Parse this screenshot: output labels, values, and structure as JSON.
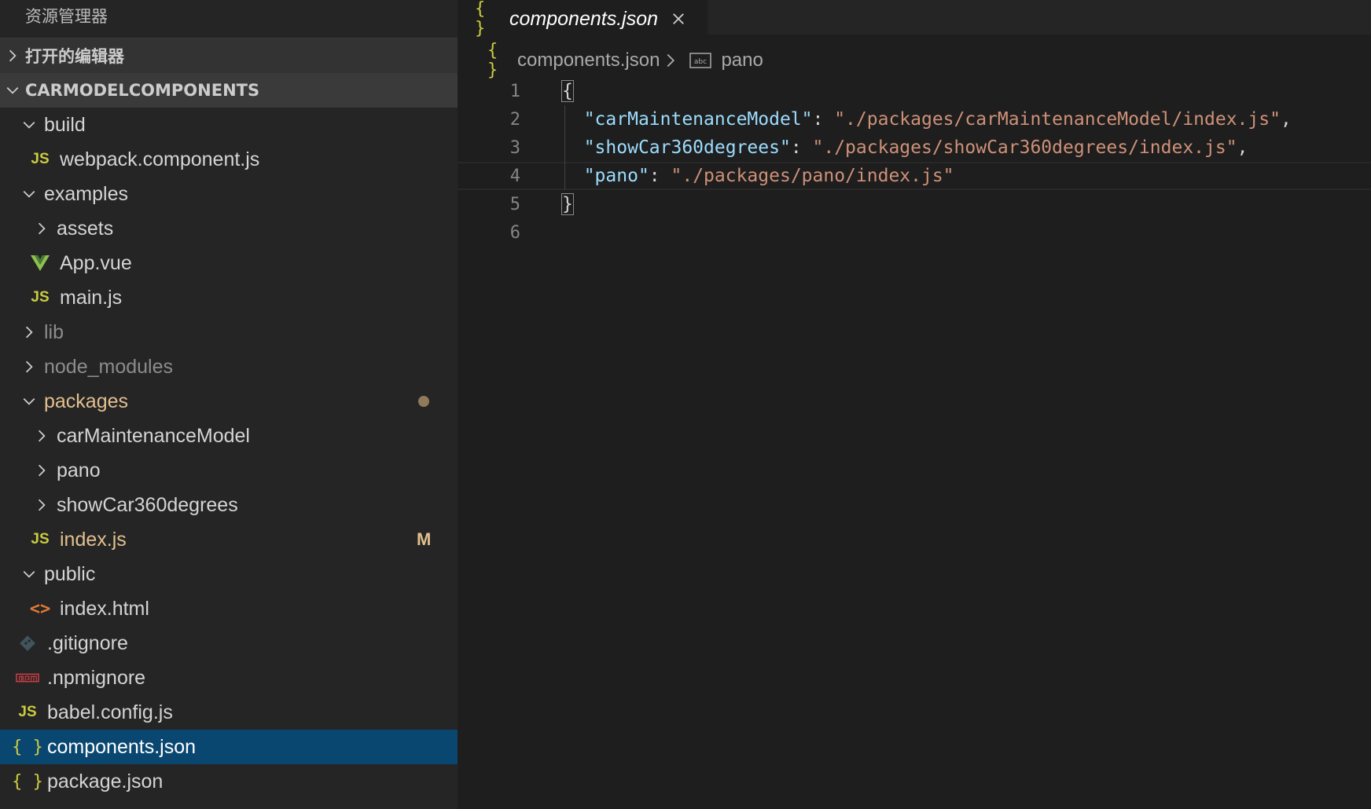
{
  "sidebar": {
    "title": "资源管理器",
    "open_editors_label": "打开的编辑器",
    "root_label": "CARMODELCOMPONENTS",
    "tree": [
      {
        "label": "build",
        "indent": 1,
        "kind": "folder",
        "open": true
      },
      {
        "label": "webpack.component.js",
        "indent": 2,
        "kind": "js"
      },
      {
        "label": "examples",
        "indent": 1,
        "kind": "folder",
        "open": true
      },
      {
        "label": "assets",
        "indent": 2,
        "kind": "folder",
        "open": false
      },
      {
        "label": "App.vue",
        "indent": 2,
        "kind": "vue"
      },
      {
        "label": "main.js",
        "indent": 2,
        "kind": "js"
      },
      {
        "label": "lib",
        "indent": 1,
        "kind": "folder",
        "open": false,
        "dim": true
      },
      {
        "label": "node_modules",
        "indent": 1,
        "kind": "folder",
        "open": false,
        "dim": true
      },
      {
        "label": "packages",
        "indent": 1,
        "kind": "folder",
        "open": true,
        "modified": true,
        "dot": true
      },
      {
        "label": "carMaintenanceModel",
        "indent": 2,
        "kind": "folder",
        "open": false
      },
      {
        "label": "pano",
        "indent": 2,
        "kind": "folder",
        "open": false
      },
      {
        "label": "showCar360degrees",
        "indent": 2,
        "kind": "folder",
        "open": false
      },
      {
        "label": "index.js",
        "indent": 2,
        "kind": "js",
        "modified": true,
        "badge": "M"
      },
      {
        "label": "public",
        "indent": 1,
        "kind": "folder",
        "open": true
      },
      {
        "label": "index.html",
        "indent": 2,
        "kind": "html"
      },
      {
        "label": ".gitignore",
        "indent": 1,
        "kind": "git"
      },
      {
        "label": ".npmignore",
        "indent": 1,
        "kind": "npm"
      },
      {
        "label": "babel.config.js",
        "indent": 1,
        "kind": "js"
      },
      {
        "label": "components.json",
        "indent": 1,
        "kind": "json",
        "selected": true
      },
      {
        "label": "package.json",
        "indent": 1,
        "kind": "json"
      }
    ]
  },
  "editor": {
    "tab_label": "components.json",
    "json_icon_glyph": "{ }",
    "js_icon_glyph": "JS",
    "html_icon_glyph": "<>",
    "breadcrumb": {
      "file": "components.json",
      "symbol": "pano"
    },
    "lines": [
      {
        "no": "1",
        "tokens": [
          {
            "t": "brace",
            "v": "{"
          }
        ]
      },
      {
        "no": "2",
        "tokens": [
          {
            "t": "punc",
            "v": "  "
          },
          {
            "t": "key",
            "v": "\"carMaintenanceModel\""
          },
          {
            "t": "punc",
            "v": ": "
          },
          {
            "t": "str",
            "v": "\"./packages/carMaintenanceModel/index.js\""
          },
          {
            "t": "punc",
            "v": ","
          }
        ]
      },
      {
        "no": "3",
        "tokens": [
          {
            "t": "punc",
            "v": "  "
          },
          {
            "t": "key",
            "v": "\"showCar360degrees\""
          },
          {
            "t": "punc",
            "v": ": "
          },
          {
            "t": "str",
            "v": "\"./packages/showCar360degrees/index.js\""
          },
          {
            "t": "punc",
            "v": ","
          }
        ]
      },
      {
        "no": "4",
        "current": true,
        "tokens": [
          {
            "t": "punc",
            "v": "  "
          },
          {
            "t": "key",
            "v": "\"pano\""
          },
          {
            "t": "punc",
            "v": ": "
          },
          {
            "t": "str",
            "v": "\"./packages/pano/index.js\""
          }
        ]
      },
      {
        "no": "5",
        "tokens": [
          {
            "t": "brace",
            "v": "}"
          }
        ]
      },
      {
        "no": "6",
        "tokens": []
      }
    ]
  },
  "colors": {
    "sidebar_bg": "#252526",
    "editor_bg": "#1e1e1e",
    "selection": "#094771",
    "modified": "#e2c08d",
    "json_key": "#9cdcfe",
    "json_string": "#ce9178"
  }
}
